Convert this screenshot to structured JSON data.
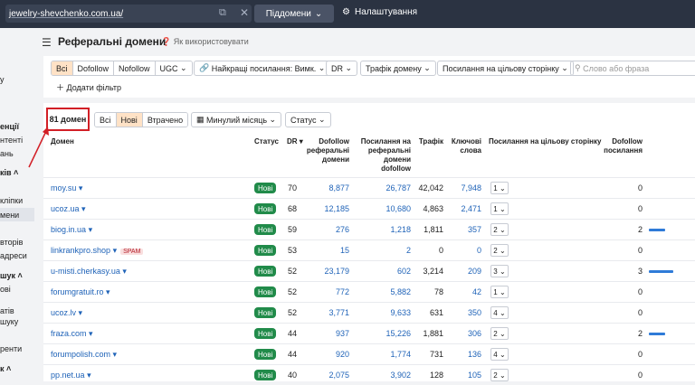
{
  "topbar": {
    "url": "jewelry-shevchenko.com.ua/",
    "mode": "Піддомени",
    "settings": "Налаштування"
  },
  "sidebar": {
    "items": [
      "у",
      "енції",
      "нтенті",
      "ань",
      "ків ˄",
      "кліпки",
      "мени",
      "вторів",
      "адреси",
      "шук ˄",
      "ові",
      "атів",
      "шуку",
      "ренти",
      "к ˄"
    ]
  },
  "header": {
    "title": "Реферальні домени",
    "howto": "Як використовувати"
  },
  "filters": {
    "link_types": [
      "Всі",
      "Dofollow",
      "Nofollow",
      "UGC"
    ],
    "best_links": "Найкращі посилання: Вимк.",
    "dr": "DR",
    "traffic": "Трафік домену",
    "target_links": "Посилання на цільову сторінку",
    "search_placeholder": "Слово або фраза",
    "add_filter": "Додати фільтр"
  },
  "toolbar": {
    "count": "81 домен",
    "status_tabs": [
      "Всі",
      "Нові",
      "Втрачено"
    ],
    "period": "Минулий місяць",
    "status": "Статус"
  },
  "columns": {
    "domain": "Домен",
    "status": "Статус",
    "dr": "DR",
    "dofollow_ref": [
      "Dofollow",
      "реферальні",
      "домени"
    ],
    "links_to_ref": [
      "Посилання на",
      "реферальні",
      "домени",
      "dofollow"
    ],
    "traffic": "Трафік",
    "keywords": [
      "Ключові",
      "слова"
    ],
    "target_links": "Посилання на цільову сторінку",
    "dofollow_links": [
      "Dofollow",
      "посилання"
    ]
  },
  "rows": [
    {
      "domain": "moy.su",
      "status": "Нові",
      "dr": "70",
      "dofollow_ref": "8,877",
      "links_ref": "26,787",
      "traffic": "42,042",
      "keywords": "7,948",
      "target": "1",
      "dofollow": "0",
      "bar": 0,
      "spam": ""
    },
    {
      "domain": "ucoz.ua",
      "status": "Нові",
      "dr": "68",
      "dofollow_ref": "12,185",
      "links_ref": "10,680",
      "traffic": "4,863",
      "keywords": "2,471",
      "target": "1",
      "dofollow": "0",
      "bar": 0,
      "spam": ""
    },
    {
      "domain": "biog.in.ua",
      "status": "Нові",
      "dr": "59",
      "dofollow_ref": "276",
      "links_ref": "1,218",
      "traffic": "1,811",
      "keywords": "357",
      "target": "2",
      "dofollow": "2",
      "bar": 2,
      "spam": ""
    },
    {
      "domain": "linkrankpro.shop",
      "status": "Нові",
      "dr": "53",
      "dofollow_ref": "15",
      "links_ref": "2",
      "traffic": "0",
      "keywords": "0",
      "target": "2",
      "dofollow": "0",
      "bar": 0,
      "spam": "SPAM"
    },
    {
      "domain": "u-misti.cherkasy.ua",
      "status": "Нові",
      "dr": "52",
      "dofollow_ref": "23,179",
      "links_ref": "602",
      "traffic": "3,214",
      "keywords": "209",
      "target": "3",
      "dofollow": "3",
      "bar": 3,
      "spam": ""
    },
    {
      "domain": "forumgratuit.ro",
      "status": "Нові",
      "dr": "52",
      "dofollow_ref": "772",
      "links_ref": "5,882",
      "traffic": "78",
      "keywords": "42",
      "target": "1",
      "dofollow": "0",
      "bar": 0,
      "spam": ""
    },
    {
      "domain": "ucoz.lv",
      "status": "Нові",
      "dr": "52",
      "dofollow_ref": "3,771",
      "links_ref": "9,633",
      "traffic": "631",
      "keywords": "350",
      "target": "4",
      "dofollow": "0",
      "bar": 0,
      "spam": ""
    },
    {
      "domain": "fraza.com",
      "status": "Нові",
      "dr": "44",
      "dofollow_ref": "937",
      "links_ref": "15,226",
      "traffic": "1,881",
      "keywords": "306",
      "target": "2",
      "dofollow": "2",
      "bar": 2,
      "spam": ""
    },
    {
      "domain": "forumpolish.com",
      "status": "Нові",
      "dr": "44",
      "dofollow_ref": "920",
      "links_ref": "1,774",
      "traffic": "731",
      "keywords": "136",
      "target": "4",
      "dofollow": "0",
      "bar": 0,
      "spam": ""
    },
    {
      "domain": "pp.net.ua",
      "status": "Нові",
      "dr": "40",
      "dofollow_ref": "2,075",
      "links_ref": "3,902",
      "traffic": "128",
      "keywords": "105",
      "target": "2",
      "dofollow": "0",
      "bar": 0,
      "spam": ""
    }
  ]
}
